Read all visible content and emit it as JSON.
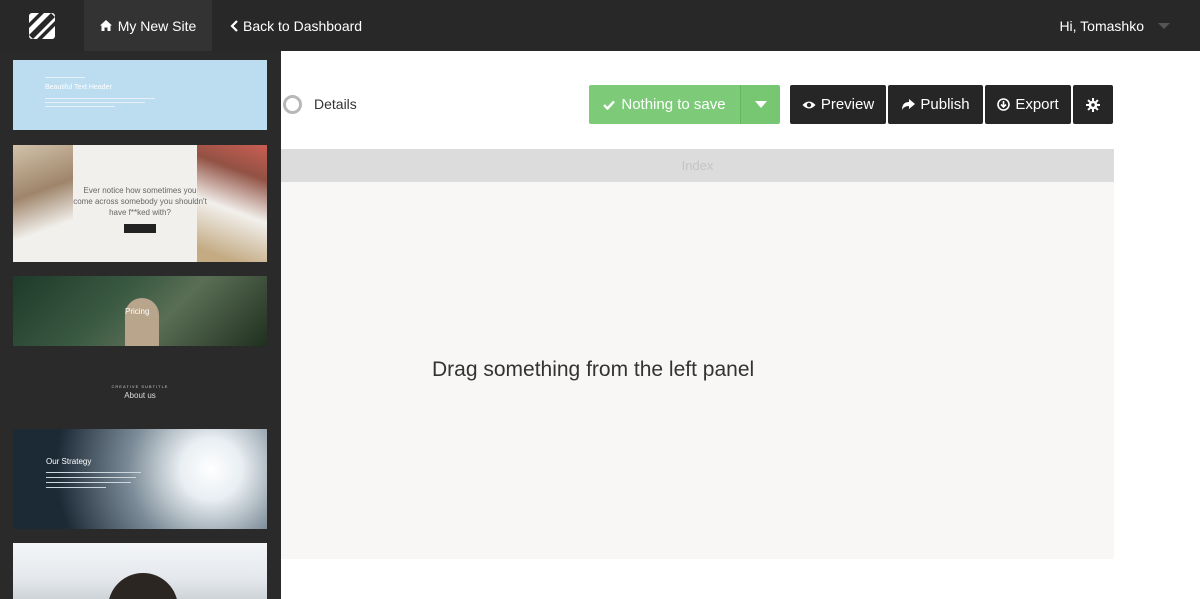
{
  "topbar": {
    "logo_icon": "stripes-logo-icon",
    "site_tab_label": "My New Site",
    "site_tab_icon": "home-icon",
    "back_label": "Back to Dashboard",
    "back_icon": "chevron-left-icon",
    "user_greeting": "Hi, Tomashko"
  },
  "sidebar": {
    "thumbnails": [
      {
        "title": "Beautiful Text Header"
      },
      {
        "title": "Ever notice how sometimes you come across somebody you shouldn't have f**ked with?"
      },
      {
        "title": "Pricing"
      },
      {
        "subtitle": "CREATIVE SUBTITLE",
        "title": "About us"
      },
      {
        "title": "Our Strategy"
      },
      {
        "title": ""
      }
    ]
  },
  "toolbar": {
    "details_label": "Details",
    "save_label": "Nothing to save",
    "preview_label": "Preview",
    "publish_label": "Publish",
    "export_label": "Export",
    "settings_icon": "gear-icon"
  },
  "canvas": {
    "page_name": "Index",
    "placeholder": "Drag something from the left panel"
  },
  "colors": {
    "topbar": "#282828",
    "sidebar": "#2a2a2a",
    "save_green": "#7dcb79",
    "dark_button": "#262626",
    "index_bar": "#dcdcdc",
    "canvas": "#f8f7f5"
  }
}
